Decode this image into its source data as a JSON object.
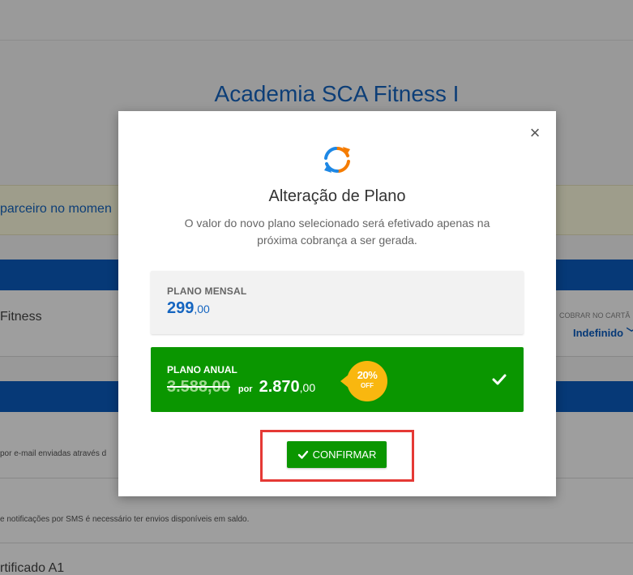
{
  "background": {
    "title": "Academia SCA Fitness I",
    "notice_text": "parceiro no momen",
    "row_name": "Fitness",
    "cobrar_label": "COBRAR NO CARTÃ",
    "cobrar_value": "Indefinido",
    "email_text": "por e-mail enviadas através d",
    "sms_text": "e notificações por SMS é necessário ter envios disponíveis em saldo.",
    "cert_text": "rtificado A1"
  },
  "modal": {
    "close_label": "×",
    "icon": "refresh-icon",
    "title": "Alteração de Plano",
    "description": "O valor do novo plano selecionado será efetivado apenas na próxima cobrança a ser gerada.",
    "plans": {
      "mensal": {
        "label": "PLANO MENSAL",
        "price_int": "299",
        "price_dec": ",00"
      },
      "anual": {
        "label": "PLANO ANUAL",
        "old_price": "3.588,00",
        "por": "por",
        "price_int": "2.870",
        "price_dec": ",00",
        "discount_pct": "20%",
        "discount_off": "OFF",
        "selected": true
      }
    },
    "confirm_label": "CONFIRMAR"
  },
  "colors": {
    "brand_blue": "#1565c0",
    "green": "#0a9600",
    "badge": "#f9b70f",
    "highlight": "#e53935"
  }
}
